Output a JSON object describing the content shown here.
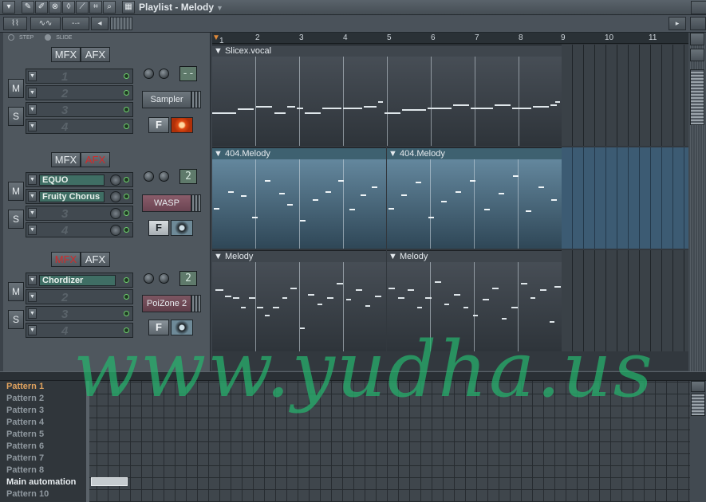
{
  "window": {
    "title": "Playlist - Melody",
    "title_arrow": "▼"
  },
  "toolbar": {
    "nav_left": "◂",
    "nav_right": "▸"
  },
  "mode": {
    "step": "STEP",
    "slide": "SLIDE"
  },
  "ruler": {
    "bars": [
      "1",
      "2",
      "3",
      "4",
      "5",
      "6",
      "7",
      "8",
      "9",
      "10",
      "11"
    ]
  },
  "tracks": [
    {
      "mfx": "MFX",
      "afx": "AFX",
      "afx_active": false,
      "mfx_active": false,
      "slots": [
        {
          "label": "",
          "num": "1"
        },
        {
          "label": "",
          "num": "2"
        },
        {
          "label": "",
          "num": "3"
        },
        {
          "label": "",
          "num": "4"
        }
      ],
      "display": "--",
      "instrument": "Sampler",
      "f": "F",
      "patterns": [
        {
          "name": "Slicex.vocal"
        }
      ]
    },
    {
      "mfx": "MFX",
      "afx": "AFX",
      "afx_active": true,
      "mfx_active": false,
      "slots": [
        {
          "label": "EQUO",
          "num": ""
        },
        {
          "label": "Fruity Chorus",
          "num": ""
        },
        {
          "label": "",
          "num": "3"
        },
        {
          "label": "",
          "num": "4"
        }
      ],
      "display": "2",
      "instrument": "WASP",
      "f": "F",
      "patterns": [
        {
          "name": "404.Melody"
        },
        {
          "name": "404.Melody"
        }
      ]
    },
    {
      "mfx": "MFX",
      "afx": "AFX",
      "afx_active": false,
      "mfx_active": true,
      "slots": [
        {
          "label": "Chordizer",
          "num": ""
        },
        {
          "label": "",
          "num": "2"
        },
        {
          "label": "",
          "num": "3"
        },
        {
          "label": "",
          "num": "4"
        }
      ],
      "display": "2",
      "instrument": "PoiZone 2",
      "f": "F",
      "patterns": [
        {
          "name": "Melody"
        },
        {
          "name": "Melody"
        }
      ]
    }
  ],
  "ms": {
    "m": "M",
    "s": "S"
  },
  "pattern_list": [
    "Pattern 1",
    "Pattern 2",
    "Pattern 3",
    "Pattern 4",
    "Pattern 5",
    "Pattern 6",
    "Pattern 7",
    "Pattern 8",
    "Main automation",
    "Pattern 10"
  ],
  "watermark": "www.yudha.us",
  "colors": {
    "accent_orange": "#e0a25e",
    "plugin_green": "#3f6e64",
    "selected_blue": "#3e6170",
    "watermark_green": "#26b46e"
  }
}
